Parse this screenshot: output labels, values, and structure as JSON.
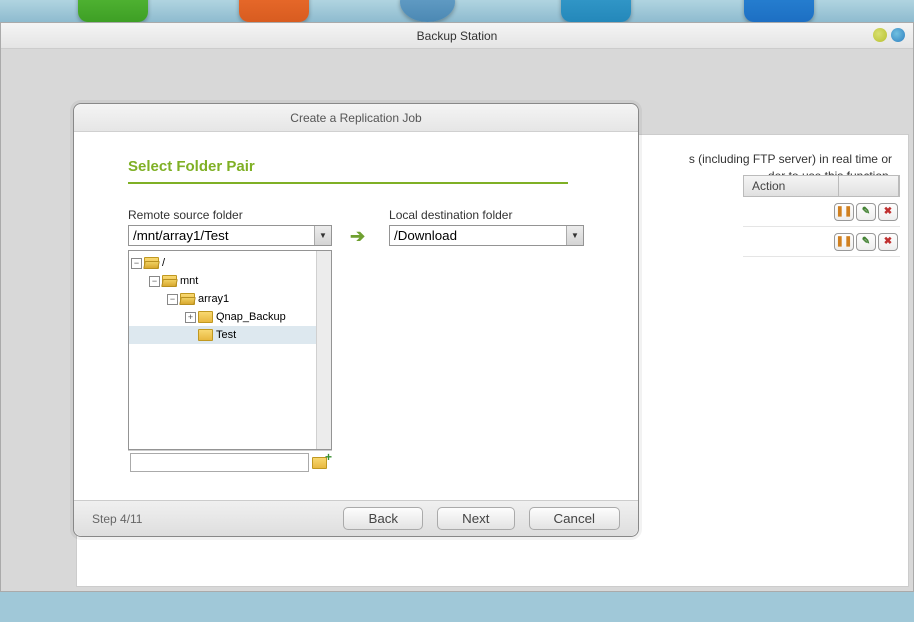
{
  "window": {
    "title": "Backup Station"
  },
  "background": {
    "hint_text_1": "s (including FTP server) in real time or",
    "hint_text_2": "der to use this function.",
    "header_action": "Action"
  },
  "modal": {
    "title": "Create a Replication Job",
    "section_title": "Select Folder Pair",
    "remote_label": "Remote source folder",
    "remote_value": "/mnt/array1/Test",
    "local_label": "Local destination folder",
    "local_value": "/Download",
    "tree": {
      "root": "/",
      "mnt": "mnt",
      "array1": "array1",
      "qnap": "Qnap_Backup",
      "test": "Test"
    },
    "step": "Step 4/11",
    "back": "Back",
    "next": "Next",
    "cancel": "Cancel"
  }
}
